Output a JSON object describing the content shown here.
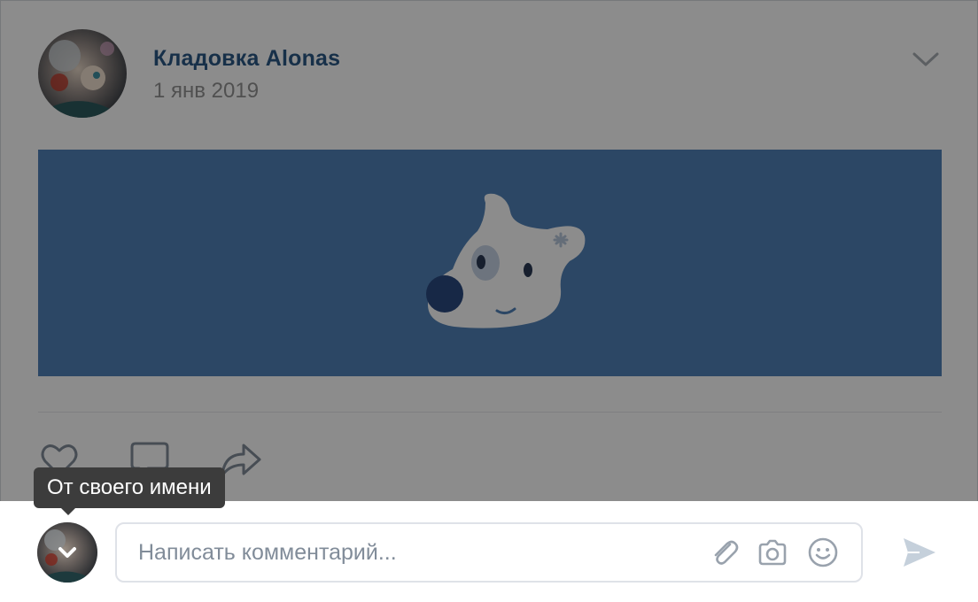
{
  "post": {
    "author": "Кладовка Alonas",
    "date": "1 янв 2019"
  },
  "icons": {
    "menu": "chevron-down-icon",
    "like": "heart-icon",
    "comment": "comment-icon",
    "share": "share-icon",
    "attach": "paperclip-icon",
    "photo": "camera-icon",
    "emoji": "smile-icon",
    "send": "send-icon",
    "avatar_toggle": "chevron-down-icon"
  },
  "composer": {
    "placeholder": "Написать комментарий...",
    "value": ""
  },
  "tooltip": {
    "text": "От своего имени"
  },
  "colors": {
    "accent": "#2a5885",
    "banner": "#5181b8",
    "overlay": "rgba(0,0,0,0.45)",
    "tooltip": "#3c3c3c"
  }
}
